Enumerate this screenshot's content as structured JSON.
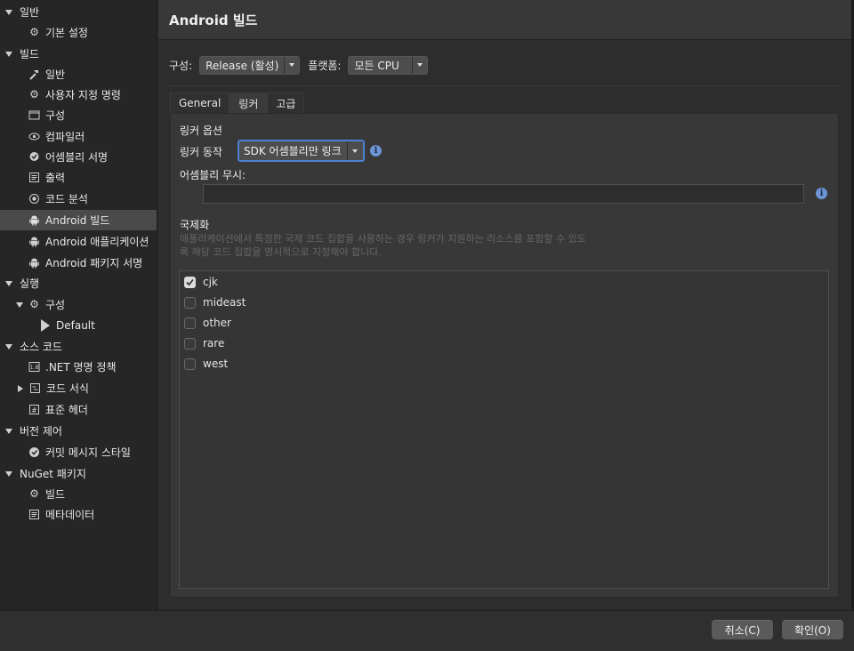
{
  "sidebar": {
    "items": [
      {
        "label": "일반",
        "kind": "group",
        "expanded": true
      },
      {
        "label": "기본 설정",
        "icon": "gear-icon"
      },
      {
        "label": "빌드",
        "kind": "group",
        "expanded": true
      },
      {
        "label": "일반",
        "icon": "hammer-icon"
      },
      {
        "label": "사용자 지정 명령",
        "icon": "gear-icon"
      },
      {
        "label": "구성",
        "icon": "window-icon"
      },
      {
        "label": "컴파일러",
        "icon": "eye-icon"
      },
      {
        "label": "어셈블리 서명",
        "icon": "badge-icon"
      },
      {
        "label": "출력",
        "icon": "document-icon"
      },
      {
        "label": "코드 분석",
        "icon": "target-icon"
      },
      {
        "label": "Android 빌드",
        "icon": "android-icon",
        "selected": true
      },
      {
        "label": "Android 애플리케이션",
        "icon": "android-icon"
      },
      {
        "label": "Android 패키지 서명",
        "icon": "android-icon"
      },
      {
        "label": "실행",
        "kind": "group",
        "expanded": true
      },
      {
        "label": "구성",
        "icon": "gear-icon",
        "expanded": true
      },
      {
        "label": "Default",
        "icon": "play-icon"
      },
      {
        "label": "소스 코드",
        "kind": "group",
        "expanded": true
      },
      {
        "label": ".NET 명명 정책",
        "icon": "naming-icon"
      },
      {
        "label": "코드 서식",
        "icon": "format-icon",
        "collapsed": true
      },
      {
        "label": "표준 헤더",
        "icon": "hash-icon"
      },
      {
        "label": "버전 제어",
        "kind": "group",
        "expanded": true
      },
      {
        "label": "커밋 메시지 스타일",
        "icon": "commit-icon"
      },
      {
        "label": "NuGet 패키지",
        "kind": "group",
        "expanded": true
      },
      {
        "label": "빌드",
        "icon": "gear-icon"
      },
      {
        "label": "메타데이터",
        "icon": "document-icon"
      }
    ]
  },
  "header": {
    "title": "Android 빌드"
  },
  "config": {
    "config_label": "구성:",
    "config_value": "Release (활성)",
    "platform_label": "플랫폼:",
    "platform_value": "모든 CPU"
  },
  "tabs": [
    {
      "label": "General",
      "active": false
    },
    {
      "label": "링커",
      "active": true
    },
    {
      "label": "고급",
      "active": false
    }
  ],
  "linker": {
    "options_title": "링커 옵션",
    "behavior_label": "링커 동작",
    "behavior_value": "SDK 어셈블리만 링크",
    "ignore_label": "어셈블리 무시:",
    "ignore_value": ""
  },
  "i18n": {
    "title": "국제화",
    "description": "애플리케이션에서 특정한 국제 코드 집합을 사용하는 경우 링커가 지원하는 리소스를 포함할 수 있도록 해당 코드 집합을 명시적으로 지정해야 합니다.",
    "items": [
      {
        "label": "cjk",
        "checked": true
      },
      {
        "label": "mideast",
        "checked": false
      },
      {
        "label": "other",
        "checked": false
      },
      {
        "label": "rare",
        "checked": false
      },
      {
        "label": "west",
        "checked": false
      }
    ]
  },
  "footer": {
    "cancel_label": "취소(C)",
    "ok_label": "확인(O)"
  }
}
